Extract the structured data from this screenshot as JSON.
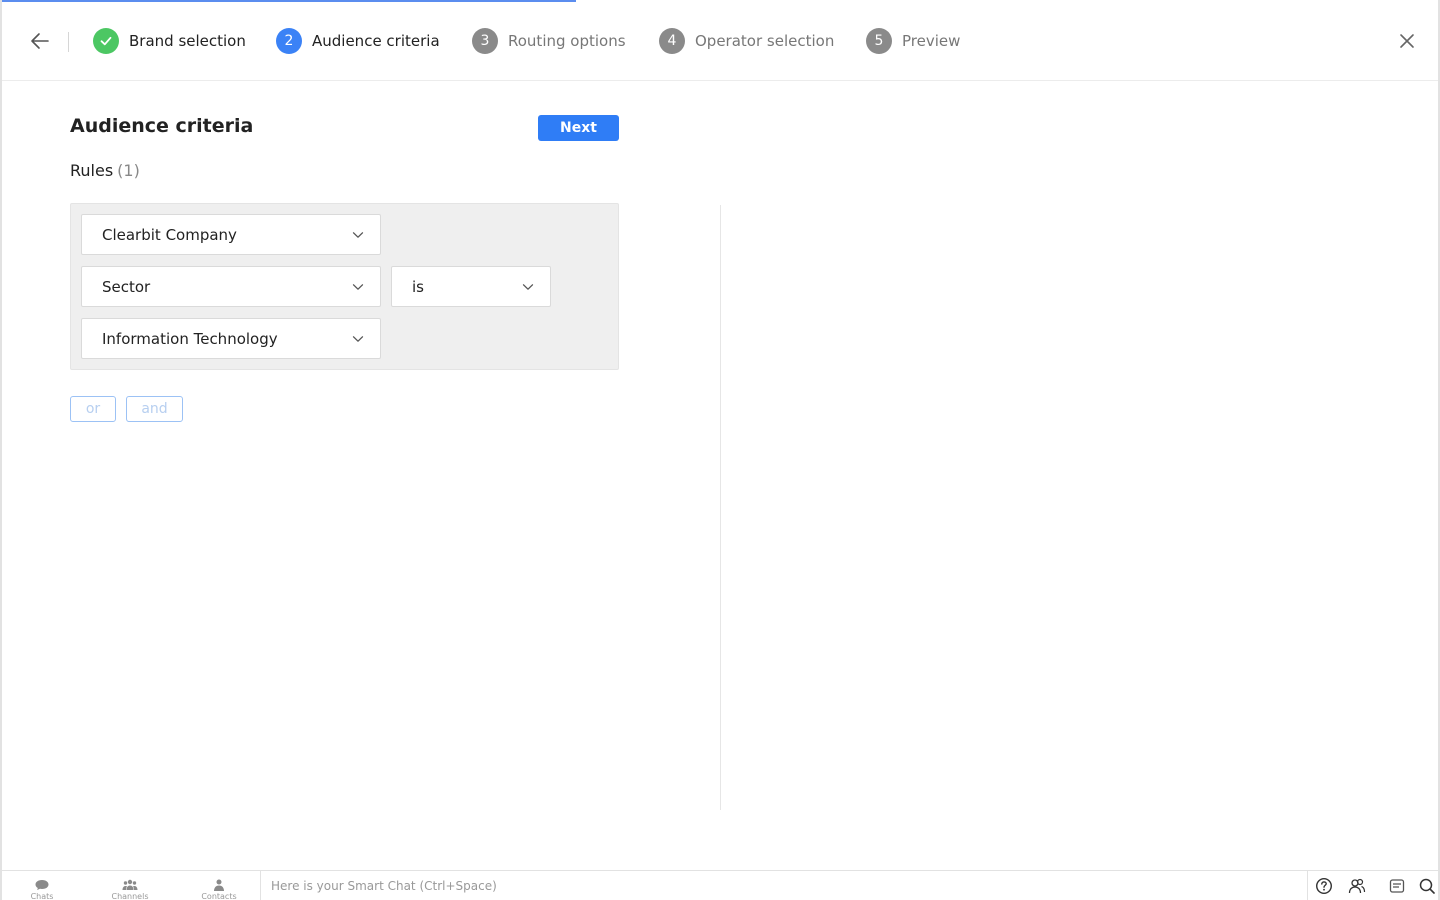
{
  "wizard": {
    "steps": [
      {
        "number": "",
        "label": "Brand selection",
        "state": "done"
      },
      {
        "number": "2",
        "label": "Audience criteria",
        "state": "active"
      },
      {
        "number": "3",
        "label": "Routing options",
        "state": "todo"
      },
      {
        "number": "4",
        "label": "Operator selection",
        "state": "todo"
      },
      {
        "number": "5",
        "label": "Preview",
        "state": "todo"
      }
    ],
    "progress_fraction": 0.4
  },
  "main": {
    "title": "Audience criteria",
    "next_label": "Next",
    "rules_label": "Rules",
    "rules_count": "(1)"
  },
  "rule": {
    "source": "Clearbit Company",
    "field": "Sector",
    "operator": "is",
    "value": "Information Technology"
  },
  "logic": {
    "or_label": "or",
    "and_label": "and"
  },
  "bottombar": {
    "chats": "Chats",
    "channels": "Channels",
    "contacts": "Contacts",
    "smart_chat_placeholder": "Here is your Smart Chat (Ctrl+Space)"
  },
  "colors": {
    "accent": "#2f7df6",
    "done": "#4cc763",
    "todo": "#8a8a8a"
  }
}
